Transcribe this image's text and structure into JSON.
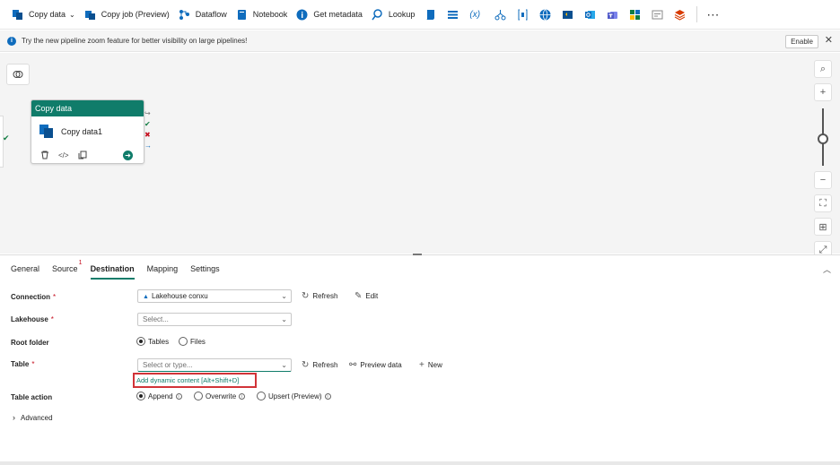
{
  "toolbar": {
    "items": [
      {
        "label": "Copy data",
        "icon": "copy-data-icon",
        "dropdown": true
      },
      {
        "label": "Copy job (Preview)",
        "icon": "copy-job-icon"
      },
      {
        "label": "Dataflow",
        "icon": "dataflow-icon"
      },
      {
        "label": "Notebook",
        "icon": "notebook-icon"
      },
      {
        "label": "Get metadata",
        "icon": "info-circle-icon"
      },
      {
        "label": "Lookup",
        "icon": "lookup-icon"
      }
    ],
    "more": "⋯"
  },
  "infobar": {
    "message": "Try the new pipeline zoom feature for better visibility on large pipelines!",
    "enable_label": "Enable",
    "close": "✕"
  },
  "canvas": {
    "activity": {
      "header": "Copy data",
      "name": "Copy data1"
    }
  },
  "panel": {
    "tabs": [
      {
        "label": "General"
      },
      {
        "label": "Source",
        "badge": "1"
      },
      {
        "label": "Destination",
        "active": true
      },
      {
        "label": "Mapping"
      },
      {
        "label": "Settings"
      }
    ],
    "connection": {
      "label": "Connection",
      "required": "*",
      "value": "Lakehouse conxu",
      "refresh": "Refresh",
      "edit": "Edit"
    },
    "lakehouse": {
      "label": "Lakehouse",
      "required": "*",
      "placeholder": "Select..."
    },
    "root_folder": {
      "label": "Root folder",
      "options": [
        "Tables",
        "Files"
      ],
      "selected": "Tables"
    },
    "table": {
      "label": "Table",
      "required": "*",
      "placeholder": "Select or type...",
      "refresh": "Refresh",
      "preview": "Preview data",
      "new": "New",
      "dynamic_content": "Add dynamic content [Alt+Shift+D]"
    },
    "table_action": {
      "label": "Table action",
      "options": [
        "Append",
        "Overwrite",
        "Upsert (Preview)"
      ],
      "selected": "Append"
    },
    "advanced": "Advanced"
  },
  "colors": {
    "accent": "#107c6a",
    "required": "#c50f1f",
    "highlight": "#d13438"
  }
}
